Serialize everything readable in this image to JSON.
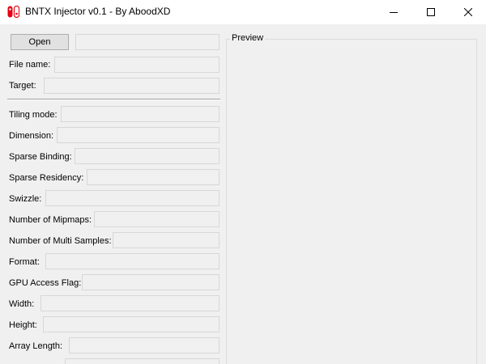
{
  "window": {
    "title": "BNTX Injector v0.1 - By AboodXD",
    "icon": "nintendo-switch-icon",
    "controls": [
      "minimize-icon",
      "maximize-icon",
      "close-icon"
    ]
  },
  "toolbar": {
    "open_label": "Open",
    "open_path": ""
  },
  "fields": [
    {
      "label": "File name:",
      "value": ""
    },
    {
      "label": "Target:",
      "value": ""
    },
    {
      "label": "Tiling mode:",
      "value": ""
    },
    {
      "label": "Dimension:",
      "value": ""
    },
    {
      "label": "Sparse Binding:",
      "value": ""
    },
    {
      "label": "Sparse Residency:",
      "value": ""
    },
    {
      "label": "Swizzle:",
      "value": ""
    },
    {
      "label": "Number of Mipmaps:",
      "value": ""
    },
    {
      "label": "Number of Multi Samples:",
      "value": ""
    },
    {
      "label": "Format:",
      "value": ""
    },
    {
      "label": "GPU Access Flag:",
      "value": ""
    },
    {
      "label": "Width:",
      "value": ""
    },
    {
      "label": "Height:",
      "value": ""
    },
    {
      "label": "Array Length:",
      "value": ""
    }
  ],
  "preview": {
    "title": "Preview"
  },
  "colors": {
    "window_bg": "#f0f0f0",
    "titlebar_bg": "#ffffff",
    "icon_red": "#e60012"
  }
}
